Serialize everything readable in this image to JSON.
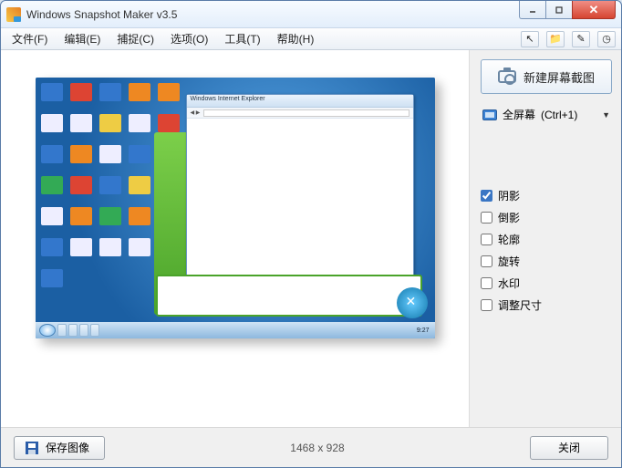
{
  "app": {
    "title": "Windows Snapshot Maker v3.5"
  },
  "menu": {
    "file": "文件(F)",
    "edit": "编辑(E)",
    "capture": "捕捉(C)",
    "options": "选项(O)",
    "tools": "工具(T)",
    "help": "帮助(H)"
  },
  "toolbar_icons": {
    "cursor": "↖",
    "folder": "📁",
    "edit": "✎",
    "clock": "◷"
  },
  "actions": {
    "new_screenshot": "新建屏幕截图",
    "fullscreen_label": "全屏幕",
    "fullscreen_shortcut": "(Ctrl+1)"
  },
  "effects": {
    "shadow": {
      "label": "阴影",
      "checked": true
    },
    "reflection": {
      "label": "倒影",
      "checked": false
    },
    "outline": {
      "label": "轮廓",
      "checked": false
    },
    "rotate": {
      "label": "旋转",
      "checked": false
    },
    "watermark": {
      "label": "水印",
      "checked": false
    },
    "resize": {
      "label": "调整尺寸",
      "checked": false
    }
  },
  "footer": {
    "save_label": "保存图像",
    "dimensions": "1468 x 928",
    "close_label": "关闭"
  },
  "preview": {
    "mini_window_title": "Windows Internet Explorer",
    "mini_clock": "9:27"
  }
}
